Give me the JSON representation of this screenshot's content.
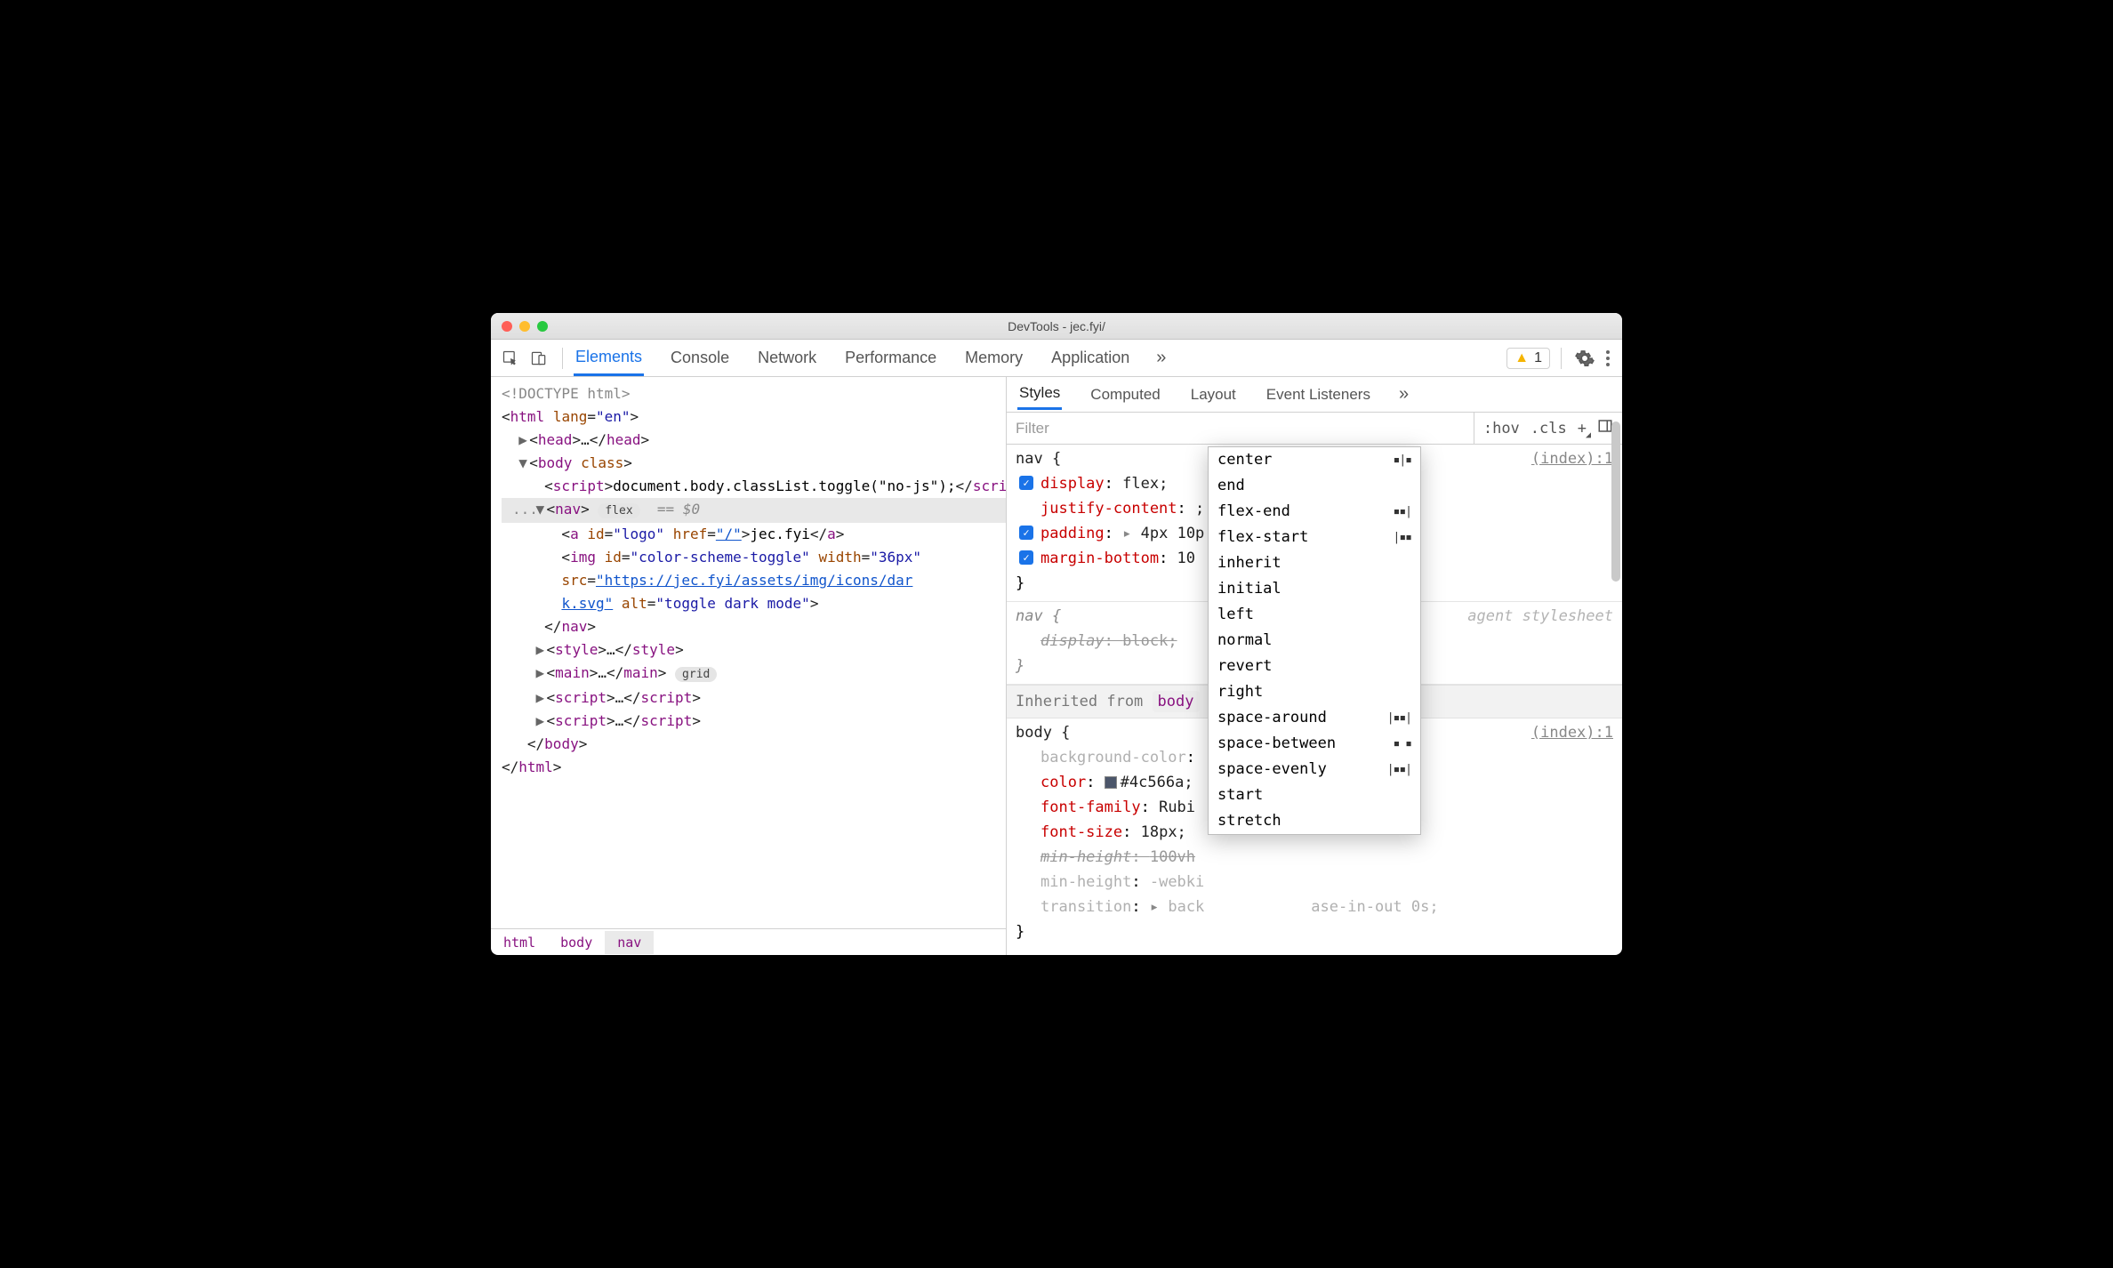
{
  "window": {
    "title": "DevTools - jec.fyi/"
  },
  "toolbar": {
    "tabs": [
      "Elements",
      "Console",
      "Network",
      "Performance",
      "Memory",
      "Application"
    ],
    "active_tab": "Elements",
    "warnings_count": "1"
  },
  "dom": {
    "doctype": "<!DOCTYPE html>",
    "html_open": "html",
    "html_lang_attr": "lang",
    "html_lang_val": "\"en\"",
    "head": "head",
    "head_ellipsis": "…",
    "body": "body",
    "body_class_attr": "class",
    "script_tag": "script",
    "script_text": "document.body.classList.toggle(\"no-js\");",
    "nav": "nav",
    "nav_badge": "flex",
    "nav_eq": "== $0",
    "a_tag": "a",
    "a_id_attr": "id",
    "a_id_val": "\"logo\"",
    "a_href_attr": "href",
    "a_href_val": "\"/\"",
    "a_text": "jec.fyi",
    "img_tag": "img",
    "img_id_attr": "id",
    "img_id_val": "\"color-scheme-toggle\"",
    "img_width_attr": "width",
    "img_width_val": "\"36px\"",
    "img_src_attr": "src",
    "img_src_val1": "\"https://jec.fyi/assets/img/icons/dar",
    "img_src_val2": "k.svg\"",
    "img_alt_attr": "alt",
    "img_alt_val": "\"toggle dark mode\"",
    "style_tag": "style",
    "main_tag": "main",
    "main_badge": "grid",
    "script2": "script",
    "script3": "script",
    "ellipsis": "…"
  },
  "crumbs": [
    "html",
    "body",
    "nav"
  ],
  "side": {
    "tabs": [
      "Styles",
      "Computed",
      "Layout",
      "Event Listeners"
    ],
    "active": "Styles",
    "filter_placeholder": "Filter",
    "hov": ":hov",
    "cls": ".cls"
  },
  "rules": {
    "r1": {
      "selector": "nav {",
      "origin": "(index):1",
      "d1_prop": "display",
      "d1_val": "flex;",
      "d2_prop": "justify-content",
      "d2_val": ";",
      "d3_prop": "padding",
      "d3_val": "4px 10p",
      "d4_prop": "margin-bottom",
      "d4_val": "10",
      "close": "}"
    },
    "r2": {
      "selector": "nav {",
      "origin_ua": "agent stylesheet",
      "d1_prop": "display",
      "d1_val": "block;",
      "close": "}"
    },
    "inherit_label": "Inherited from",
    "inherit_from": "body",
    "r3": {
      "selector": "body {",
      "origin": "(index):1",
      "d1_prop": "background-color",
      "d2_prop": "color",
      "d2_val": "#4c566a;",
      "d3_prop": "font-family",
      "d3_val": "Rubi",
      "d4_prop": "font-size",
      "d4_val": "18px;",
      "d5_prop": "min-height",
      "d5_val": "100vh",
      "d6_prop": "min-height",
      "d6_val": "-webki",
      "d7_prop": "transition",
      "d7_val": "back",
      "d7_tail": "ase-in-out 0s;",
      "close": "}"
    }
  },
  "dropdown": {
    "items": [
      {
        "label": "center",
        "glyph": "▪|▪"
      },
      {
        "label": "end",
        "glyph": ""
      },
      {
        "label": "flex-end",
        "glyph": "▪▪|"
      },
      {
        "label": "flex-start",
        "glyph": "|▪▪"
      },
      {
        "label": "inherit",
        "glyph": ""
      },
      {
        "label": "initial",
        "glyph": ""
      },
      {
        "label": "left",
        "glyph": ""
      },
      {
        "label": "normal",
        "glyph": ""
      },
      {
        "label": "revert",
        "glyph": ""
      },
      {
        "label": "right",
        "glyph": ""
      },
      {
        "label": "space-around",
        "glyph": "|▪▪|"
      },
      {
        "label": "space-between",
        "glyph": "▪ ▪"
      },
      {
        "label": "space-evenly",
        "glyph": "|▪▪|"
      },
      {
        "label": "start",
        "glyph": ""
      },
      {
        "label": "stretch",
        "glyph": ""
      }
    ]
  }
}
